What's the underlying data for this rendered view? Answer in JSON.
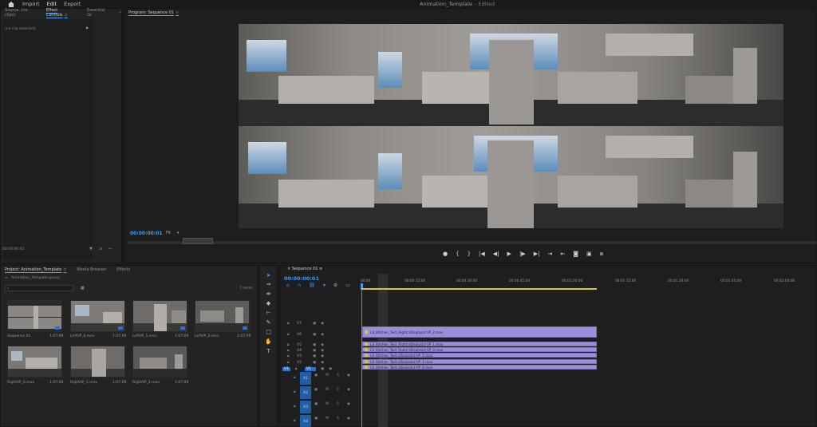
{
  "topbar": {
    "menus": [
      "Import",
      "Edit",
      "Export"
    ],
    "active_menu": "Edit",
    "document_title": "Animation_Template",
    "edited_flag": "- Edited"
  },
  "effect_controls": {
    "tabs": [
      "Source: (no clips)",
      "Effect Controls",
      "Essential Gr"
    ],
    "active_tab": "Effect Controls",
    "empty_label": "(no clip selected)",
    "footer_time": "00:00:00:01"
  },
  "program_monitor": {
    "tab": "Program: Sequence 01",
    "timecode": "00:00:00:01",
    "zoom": "Fit",
    "scene": "kitchen-panorama-stereo",
    "controls": [
      "marker-icon",
      "in-point-icon",
      "out-point-icon",
      "go-to-in-icon",
      "step-back-icon",
      "play-icon",
      "step-forward-icon",
      "go-to-out-icon",
      "insert-icon",
      "overwrite-icon",
      "export-frame-icon",
      "comparison-icon",
      "vr-icon"
    ]
  },
  "project": {
    "tabs": [
      "Project: Animation_Template",
      "Media Browser",
      "Effects"
    ],
    "active_tab": "Project: Animation_Template",
    "file": "Animation_Template.prproj",
    "search_placeholder": "",
    "item_count": "7 items",
    "items": [
      {
        "name": "Sequence 01",
        "duration": "1:07:09",
        "badge": true
      },
      {
        "name": "LeftVP_0.mov",
        "duration": "1:07:09",
        "badge": true
      },
      {
        "name": "LeftVP_1.mov",
        "duration": "1:07:09",
        "badge": true
      },
      {
        "name": "LeftVP_2.mov",
        "duration": "1:07:09",
        "badge": true
      },
      {
        "name": "RightVP_0.mov",
        "duration": "1:07:09",
        "badge": false
      },
      {
        "name": "RightVP_1.mov",
        "duration": "1:07:09",
        "badge": false
      },
      {
        "name": "RightVP_2.mov",
        "duration": "1:07:09",
        "badge": false
      }
    ]
  },
  "tools": [
    "selection-tool-icon",
    "track-select-icon",
    "ripple-edit-icon",
    "razor-icon",
    "slip-icon",
    "pen-icon",
    "rectangle-icon",
    "hand-icon",
    "type-icon"
  ],
  "timeline": {
    "tab": "Sequence 01",
    "timecode": "00:00:00:01",
    "ruler": [
      "00:00",
      "00:00:15:00",
      "00:00:30:00",
      "00:00:45:00",
      "00:01:00:00",
      "00:01:15:00",
      "00:01:30:00",
      "00:01:45:00",
      "00:02:00:00"
    ],
    "video_tracks": [
      "V7",
      "V6",
      "V5",
      "V4",
      "V3",
      "V2",
      "V1"
    ],
    "source_track": "V1",
    "audio_tracks": [
      "A1",
      "A2",
      "A3",
      "A4"
    ],
    "audio_buttons": [
      "M",
      "S"
    ],
    "clips": [
      {
        "label": "LS_Kitchen_Test_Right:cDisplayLt:VP_2.mov"
      },
      {
        "label": "LS_Kitchen_Test_Right:cDisplayLt:VP_1.mov"
      },
      {
        "label": "LS_Kitchen_Test_Right:cDisplayLt:VP_0.mov"
      },
      {
        "label": "LS_Kitchen_Test:cDisplayLt:VP_2.mov"
      },
      {
        "label": "LS_Kitchen_Test:cDisplayLt:VP_1.mov"
      },
      {
        "label": "LS_Kitchen_Test:cDisplayLt:VP_0.mov"
      }
    ]
  },
  "colors": {
    "accent": "#3e9cff",
    "clip": "#9b8edb",
    "workarea": "#d6c43e",
    "track_target": "#2d6fd9"
  }
}
